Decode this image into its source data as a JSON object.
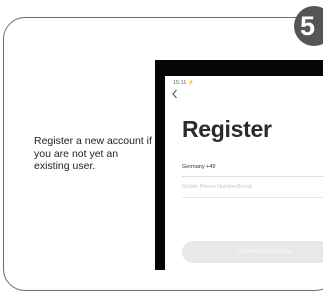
{
  "step_number": "5",
  "instruction": "Register a new account if you are not yet an existing user.",
  "phone_screen": {
    "status_time": "15:11 ⚡",
    "title": "Register",
    "country": "Germany  +49",
    "phone_placeholder": "Mobile Phone Number/Email",
    "code_button_label": "Get Verification Code"
  },
  "icons": {
    "back": "chevron-left-icon"
  },
  "colors": {
    "badge": "#555555",
    "card_border": "#6b6b6b",
    "phone_frame": "#050505",
    "code_button": "#e8e8e8"
  }
}
